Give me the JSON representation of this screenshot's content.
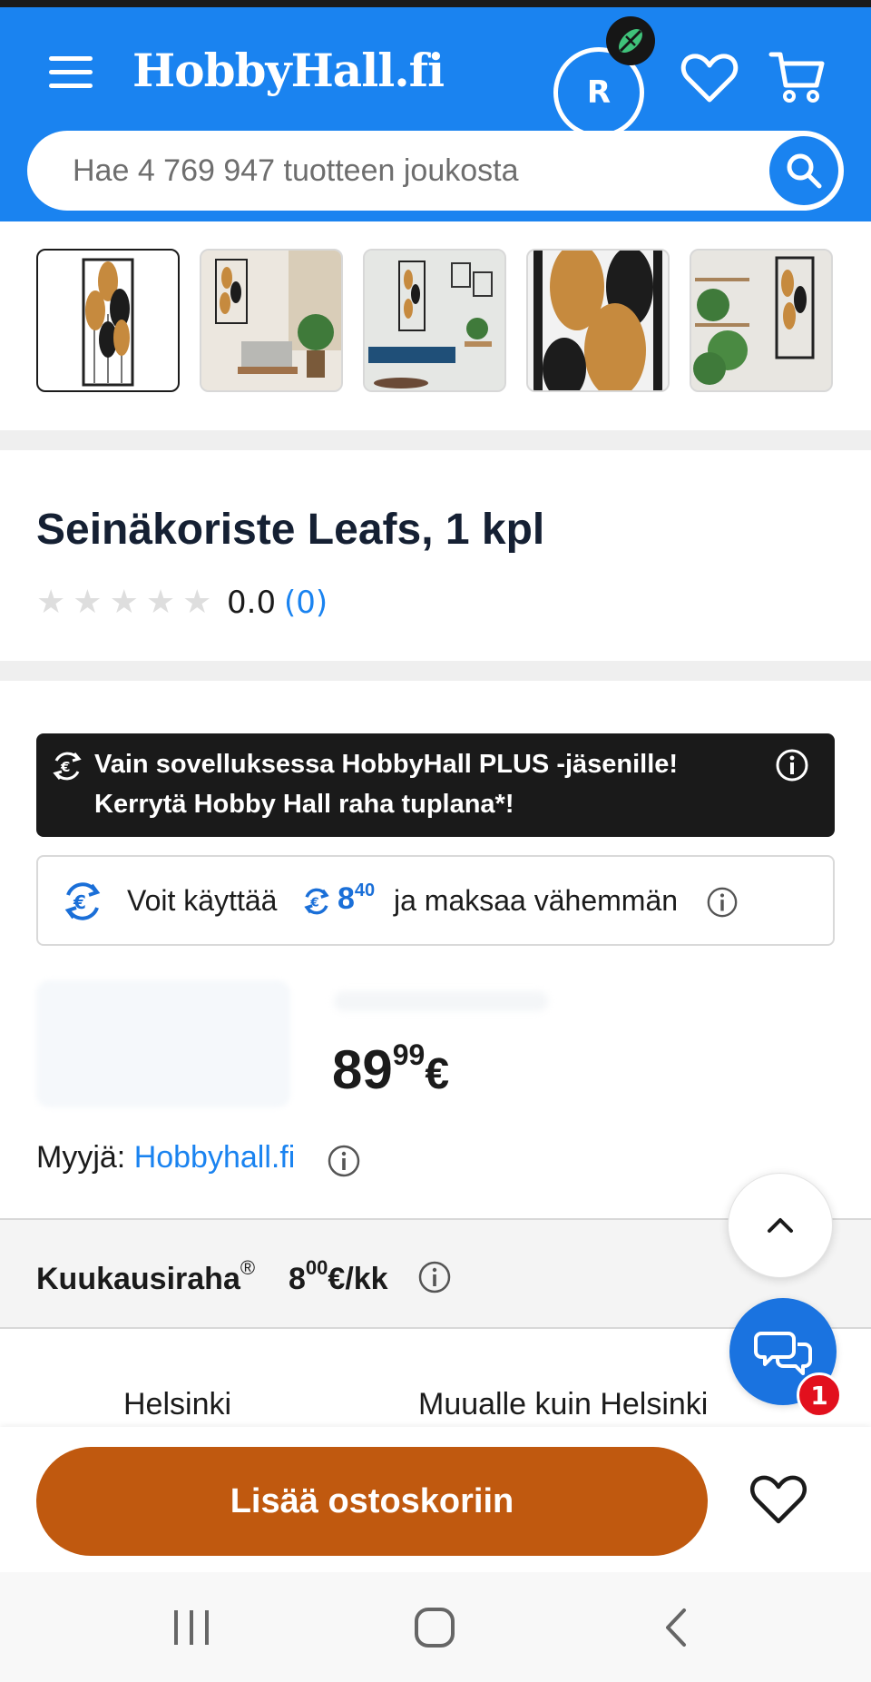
{
  "header": {
    "logo": "HobbyHall.fi",
    "avatar_initial": "R",
    "search_placeholder": "Hae 4 769 947 tuotteen joukosta"
  },
  "icons": {
    "menu": "menu-icon",
    "badge": "leaf-badge-icon",
    "wishlist": "heart-icon",
    "cart": "cart-icon",
    "search": "search-icon",
    "coin": "coin-exchange-icon",
    "info": "info-icon",
    "scroll_top": "chevron-up-icon",
    "chat": "chat-icon"
  },
  "gallery": {
    "thumbnails": [
      "leaf-wall-decor-front",
      "leaf-decor-living-room",
      "leaf-decor-bench-room",
      "leaf-decor-closeup",
      "leaf-decor-shelf-plants"
    ],
    "selected_index": 0
  },
  "product": {
    "title": "Seinäkoriste Leafs, 1 kpl",
    "rating_value": "0.0",
    "rating_count": "(0)",
    "stars_filled": 0,
    "stars_total": 5
  },
  "plus_banner": {
    "line1": "Vain sovelluksessa HobbyHall PLUS -jäsenille!",
    "line2": "Kerrytä Hobby Hall raha tuplana*!"
  },
  "hobbyhall_money": {
    "text_before": "Voit käyttää",
    "amount_int": "8",
    "amount_dec": "40",
    "text_after": "ja maksaa vähemmän"
  },
  "price": {
    "int": "89",
    "dec": "99",
    "currency": "€"
  },
  "seller": {
    "label": "Myyjä:",
    "name": "Hobbyhall.fi"
  },
  "monthly": {
    "label": "Kuukausiraha",
    "reg": "®",
    "value_int": "8",
    "value_dec": "00",
    "unit": "€/kk"
  },
  "delivery": {
    "option1": "Helsinki",
    "option2": "Muualle kuin Helsinki"
  },
  "chat_badge": "1",
  "actions": {
    "add_to_cart": "Lisää ostoskoriin"
  },
  "colors": {
    "brand_blue": "#1a83f0",
    "cart_orange": "#c0590f",
    "banner_black": "#1a1a1a",
    "badge_red": "#e2101d"
  }
}
